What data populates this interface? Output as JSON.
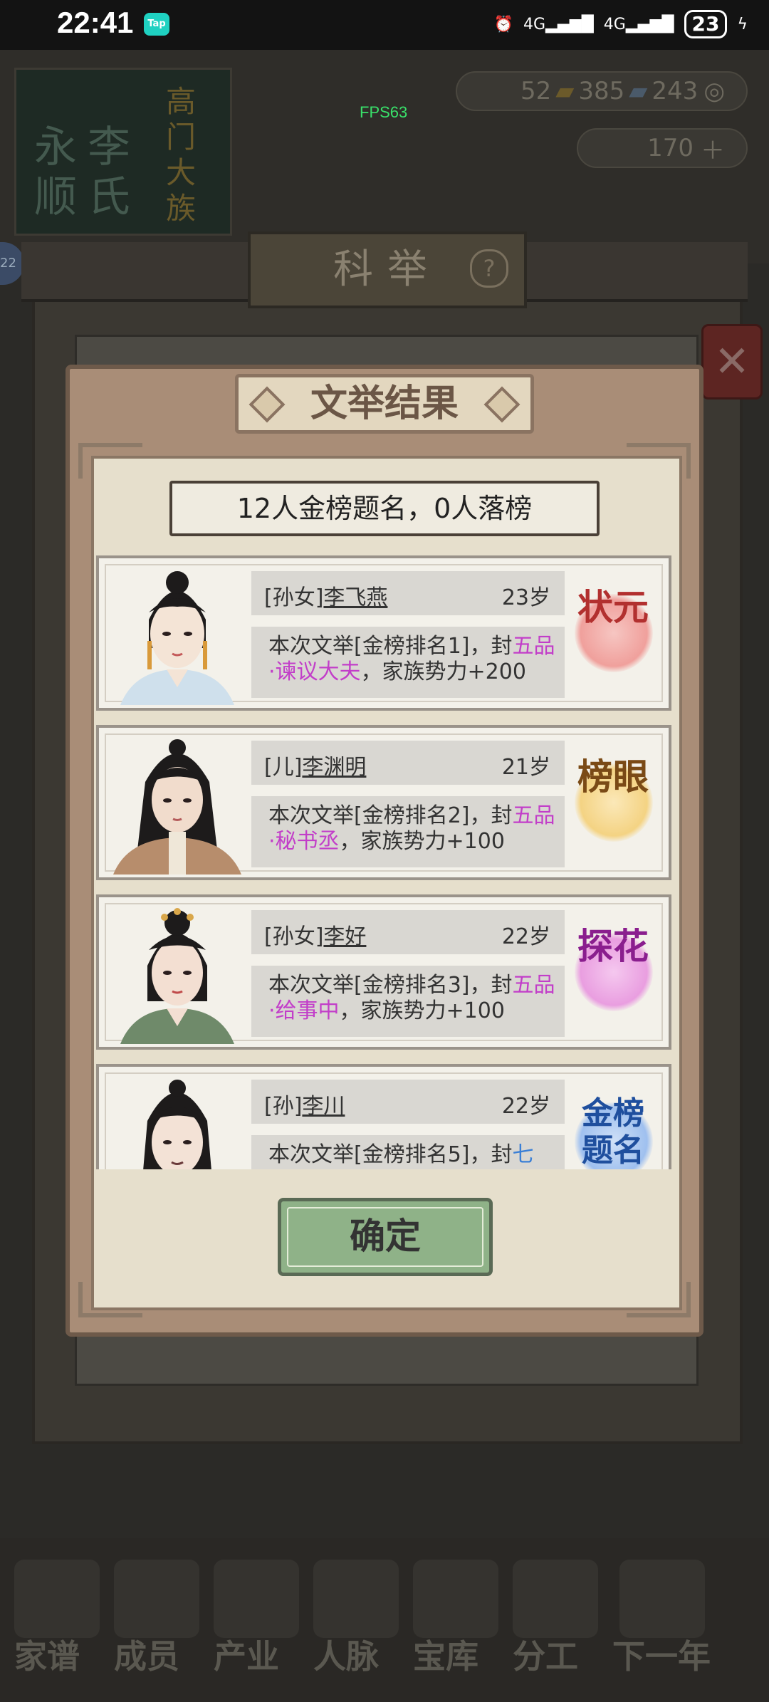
{
  "status_bar": {
    "time": "22:41",
    "tap_badge": "Tap",
    "net1": "4G",
    "net2": "4G",
    "battery": "23",
    "icons": [
      "alarm-icon",
      "signal-icon",
      "signal-icon",
      "battery-icon",
      "charging-icon"
    ]
  },
  "background": {
    "book_chars": [
      "永",
      "李",
      "顺",
      "氏"
    ],
    "book2_chars": "高门大族",
    "resources": {
      "r1": "52",
      "r2": "385",
      "r3": "243",
      "gold": "170"
    },
    "fps": "FPS63",
    "page_title": "科举",
    "help": "?",
    "side_badge": "22",
    "nav": [
      "家谱",
      "成员",
      "产业",
      "人脉",
      "宝库",
      "分工",
      "下一年"
    ]
  },
  "dialog": {
    "title": "文举结果",
    "summary": "12人金榜题名，0人落榜",
    "confirm": "确定",
    "results": [
      {
        "relation": "[孙女]",
        "name": "李飞燕",
        "age": "23岁",
        "desc_pre": "本次文举[金榜排名1]，封",
        "rank_title": "五品·谏议大夫",
        "desc_post": "，家族势力+200",
        "seal": "状元",
        "seal_color": "#e0696b",
        "hl": "purple"
      },
      {
        "relation": "[儿]",
        "name": "李渊明",
        "age": "21岁",
        "desc_pre": "本次文举[金榜排名2]，封",
        "rank_title": "五品·秘书丞",
        "desc_post": "，家族势力+100",
        "seal": "榜眼",
        "seal_color": "#e3b04a",
        "hl": "purple"
      },
      {
        "relation": "[孙女]",
        "name": "李好",
        "age": "22岁",
        "desc_pre": "本次文举[金榜排名3]，封",
        "rank_title": "五品·给事中",
        "desc_post": "，家族势力+100",
        "seal": "探花",
        "seal_color": "#c04cbf",
        "hl": "purple"
      },
      {
        "relation": "[孙]",
        "name": "李川",
        "age": "22岁",
        "desc_pre": "本次文举[金榜排名5]，封",
        "rank_title": "七",
        "desc_post": "",
        "seal": "金榜题名",
        "seal_color": "#3f72c9",
        "hl": "blue"
      }
    ]
  }
}
